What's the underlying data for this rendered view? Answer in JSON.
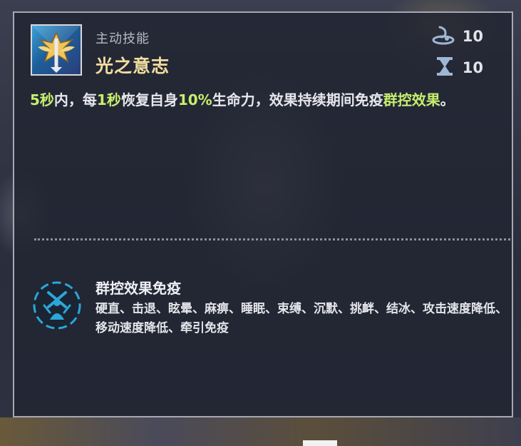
{
  "skill": {
    "type_label": "主动技能",
    "name": "光之意志",
    "icon": "golden-winged-crest-icon"
  },
  "stats": {
    "energy": {
      "icon": "energy-swirl-icon",
      "value": "10"
    },
    "cooldown": {
      "icon": "hourglass-icon",
      "value": "10"
    }
  },
  "description": {
    "segments": [
      {
        "text": "5秒",
        "highlight": true
      },
      {
        "text": "内，每",
        "highlight": false
      },
      {
        "text": "1秒",
        "highlight": true
      },
      {
        "text": "恢复自身",
        "highlight": false
      },
      {
        "text": "10%",
        "highlight": true
      },
      {
        "text": "生命力，效果持续期间免疫",
        "highlight": false
      },
      {
        "text": "群控效果",
        "highlight": true
      },
      {
        "text": "。",
        "highlight": false
      }
    ]
  },
  "effect": {
    "icon": "crowd-control-immunity-icon",
    "title": "群控效果免疫",
    "description": "硬直、击退、眩晕、麻痹、睡眠、束缚、沉默、挑衅、结冰、攻击速度降低、移动速度降低、牵引免疫"
  },
  "colors": {
    "highlight": "#c6ee6e",
    "skill_name": "#f1dd9e",
    "cc_icon": "#2aa7d8"
  }
}
